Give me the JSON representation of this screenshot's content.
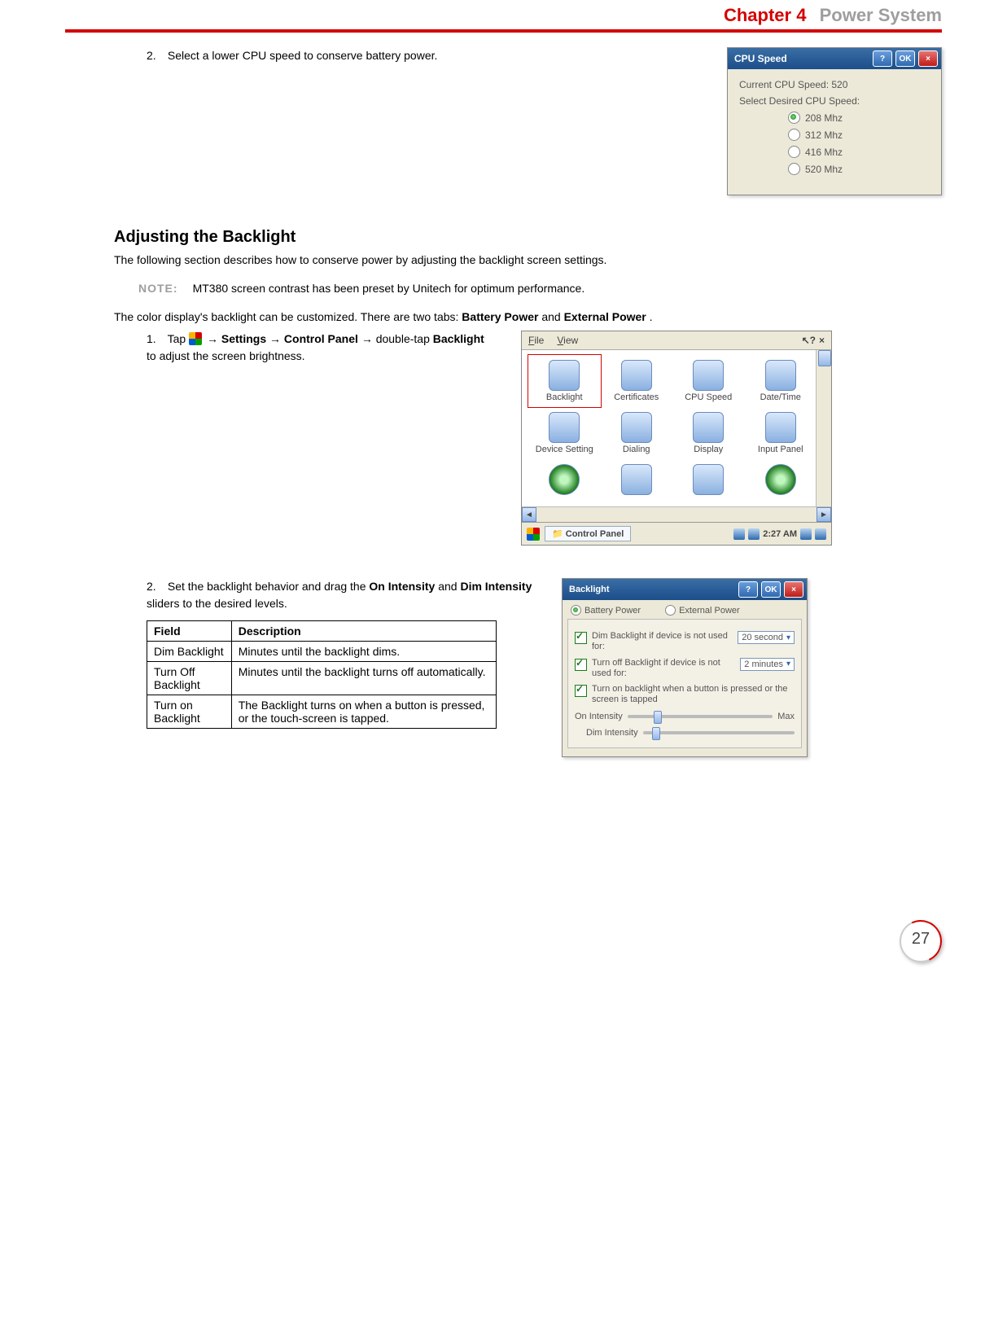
{
  "header": {
    "chapter": "Chapter 4",
    "title": "Power System"
  },
  "step2_cpu": {
    "num": "2.",
    "text": "Select a lower CPU speed to conserve battery power."
  },
  "cpu_dialog": {
    "title": "CPU Speed",
    "help_btn": "?",
    "ok_btn": "OK",
    "close_btn": "×",
    "current_label": "Current CPU Speed:  520",
    "select_label": "Select Desired CPU Speed:",
    "options": [
      "208 Mhz",
      "312 Mhz",
      "416 Mhz",
      "520 Mhz"
    ]
  },
  "section_title": "Adjusting the Backlight",
  "section_intro": "The following section describes how to conserve power by adjusting the backlight screen settings.",
  "note_label": "NOTE:",
  "note_text": "MT380 screen contrast has been preset by Unitech for optimum performance.",
  "para_tabs_pre": "The color display's backlight can be customized. There are two tabs: ",
  "para_tabs_b1": "Battery Power",
  "para_tabs_mid": " and ",
  "para_tabs_b2": "External Power",
  "para_tabs_post": ".",
  "step1_bl": {
    "num": "1.",
    "pre": "Tap ",
    "arrow": " → ",
    "settings": "Settings",
    "control_panel": "Control Panel",
    "dt": " double-tap ",
    "backlight": "Backlight",
    "post": " to adjust the screen brightness."
  },
  "control_panel": {
    "menu_file": "File",
    "menu_view": "View",
    "help": "?",
    "close": "×",
    "items": [
      "Backlight",
      "Certificates",
      "CPU Speed",
      "Date/Time",
      "Device Setting",
      "Dialing",
      "Display",
      "Input Panel"
    ],
    "taskbar_label": "Control Panel",
    "time": "2:27 AM"
  },
  "step2_bl": {
    "num": "2.",
    "pre": "Set the backlight behavior and drag the ",
    "b1": "On Intensity",
    "mid": " and ",
    "b2": "Dim Intensity",
    "post": " sliders to the desired levels."
  },
  "table": {
    "headers": [
      "Field",
      "Description"
    ],
    "rows": [
      [
        "Dim Backlight",
        "Minutes until the backlight dims."
      ],
      [
        "Turn Off Backlight",
        "Minutes until the backlight turns off automatically."
      ],
      [
        "Turn on Backlight",
        "The Backlight turns on when a button is pressed, or the touch-screen is tapped."
      ]
    ]
  },
  "bl_dialog": {
    "title": "Backlight",
    "help_btn": "?",
    "ok_btn": "OK",
    "close_btn": "×",
    "tab1": "Battery Power",
    "tab2": "External Power",
    "cb1": "Dim Backlight if device is not used for:",
    "dd1": "20 second",
    "cb2": "Turn off Backlight if device is not used for:",
    "dd2": "2 minutes",
    "cb3": "Turn on backlight when a button is pressed or the screen is tapped",
    "sld1_label": "On Intensity",
    "sld2_label": "Dim Intensity",
    "max": "Max"
  },
  "page_number": "27"
}
